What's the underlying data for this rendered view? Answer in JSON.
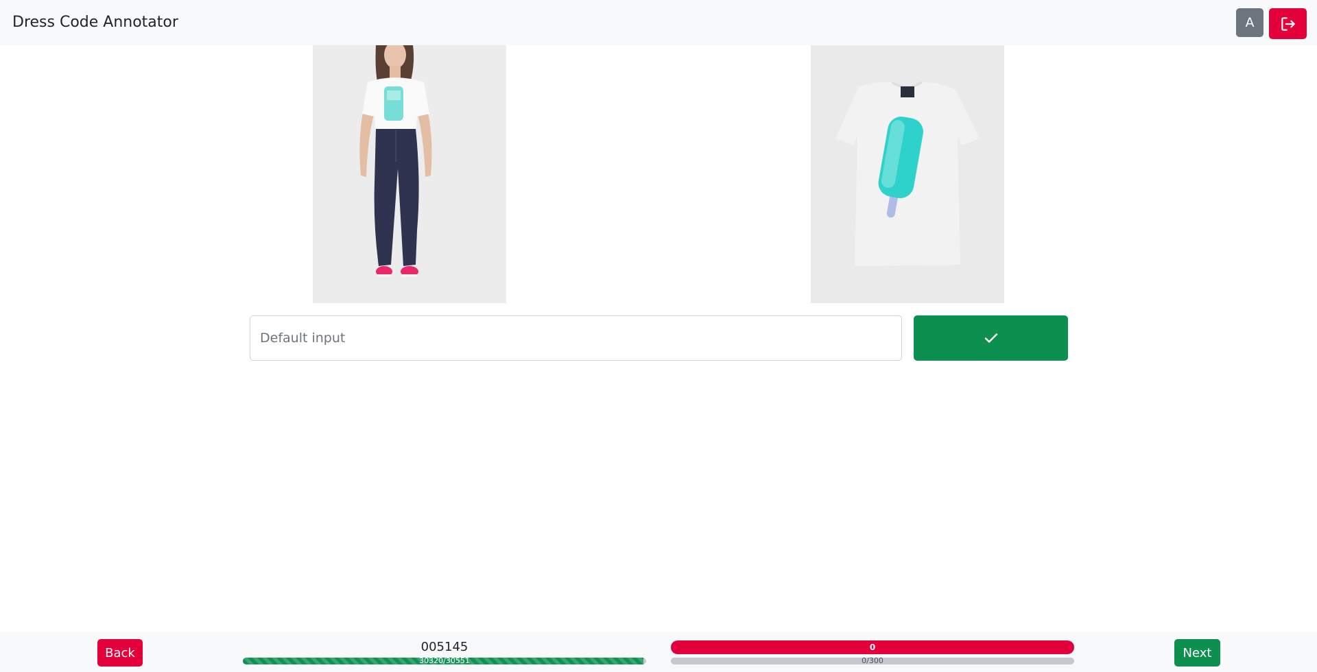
{
  "header": {
    "title": "Dress Code Annotator",
    "user_initial": "A",
    "logout_icon": "logout-icon"
  },
  "images": {
    "left_alt": "Model wearing white t-shirt with popsicle print and navy trousers",
    "right_alt": "White t-shirt with turquoise popsicle print"
  },
  "form": {
    "input_placeholder": "Default input",
    "input_value": "",
    "confirm_icon": "check-icon"
  },
  "footer": {
    "back_label": "Back",
    "next_label": "Next",
    "item_id": "005145",
    "overall_progress_label": "30320/30551",
    "overall_progress": {
      "done": 30320,
      "total": 30551
    },
    "score_label": "0",
    "session_progress_label": "0/300",
    "session_progress": {
      "done": 0,
      "total": 300
    }
  },
  "colors": {
    "danger": "#e4003a",
    "success": "#0d904f",
    "secondary": "#6c757d",
    "navbar_bg": "#f8f9fa"
  }
}
